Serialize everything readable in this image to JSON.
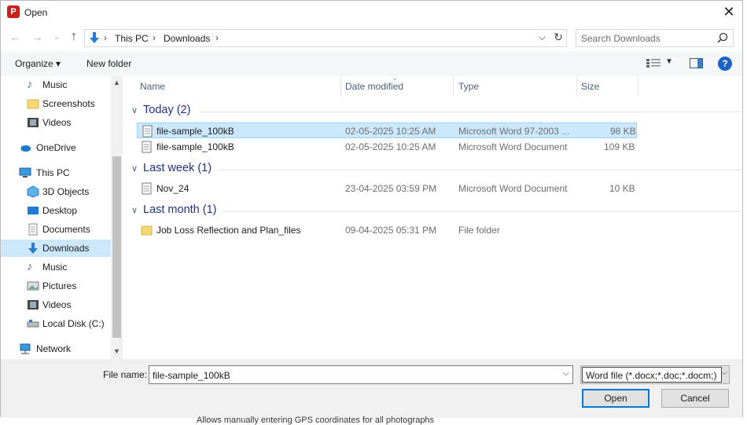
{
  "window": {
    "title": "Open",
    "app_icon": "pdf-app-icon"
  },
  "nav": {
    "back": "←",
    "forward": "→",
    "recent": "⌄",
    "up": "↑",
    "breadcrumb": [
      "This PC",
      "Downloads"
    ],
    "search_placeholder": "Search Downloads"
  },
  "toolbar": {
    "organize": "Organize ▾",
    "new_folder": "New folder"
  },
  "sidebar": {
    "items": [
      {
        "label": "Music",
        "icon": "music-icon"
      },
      {
        "label": "Screenshots",
        "icon": "folder-icon"
      },
      {
        "label": "Videos",
        "icon": "video-icon"
      },
      {
        "label": "OneDrive",
        "icon": "cloud-icon"
      },
      {
        "label": "This PC",
        "icon": "pc-icon"
      },
      {
        "label": "3D Objects",
        "icon": "cube-icon"
      },
      {
        "label": "Desktop",
        "icon": "desktop-icon"
      },
      {
        "label": "Documents",
        "icon": "document-icon"
      },
      {
        "label": "Downloads",
        "icon": "download-icon"
      },
      {
        "label": "Music",
        "icon": "music-icon"
      },
      {
        "label": "Pictures",
        "icon": "picture-icon"
      },
      {
        "label": "Videos",
        "icon": "video-icon"
      },
      {
        "label": "Local Disk (C:)",
        "icon": "drive-icon"
      },
      {
        "label": "Network",
        "icon": "network-icon"
      }
    ]
  },
  "columns": {
    "name": "Name",
    "date": "Date modified",
    "type": "Type",
    "size": "Size"
  },
  "groups": [
    {
      "label": "Today (2)",
      "files": [
        {
          "name": "file-sample_100kB",
          "date": "02-05-2025 10:25 AM",
          "type": "Microsoft Word 97-2003 ...",
          "size": "98 KB"
        },
        {
          "name": "file-sample_100kB",
          "date": "02-05-2025 10:25 AM",
          "type": "Microsoft Word Document",
          "size": "109 KB"
        }
      ]
    },
    {
      "label": "Last week (1)",
      "files": [
        {
          "name": "Nov_24",
          "date": "23-04-2025 03:59 PM",
          "type": "Microsoft Word Document",
          "size": "10 KB"
        }
      ]
    },
    {
      "label": "Last month (1)",
      "files": [
        {
          "name": "Job Loss Reflection and Plan_files",
          "date": "09-04-2025 05:31 PM",
          "type": "File folder",
          "size": ""
        }
      ]
    }
  ],
  "bottom": {
    "file_name_label": "File name:",
    "file_name_value": "file-sample_100kB",
    "filter": "Word file (*.docx;*.doc;*.docm;)",
    "open": "Open",
    "cancel": "Cancel"
  },
  "background_text": "Allows manually entering GPS coordinates for all photographs"
}
